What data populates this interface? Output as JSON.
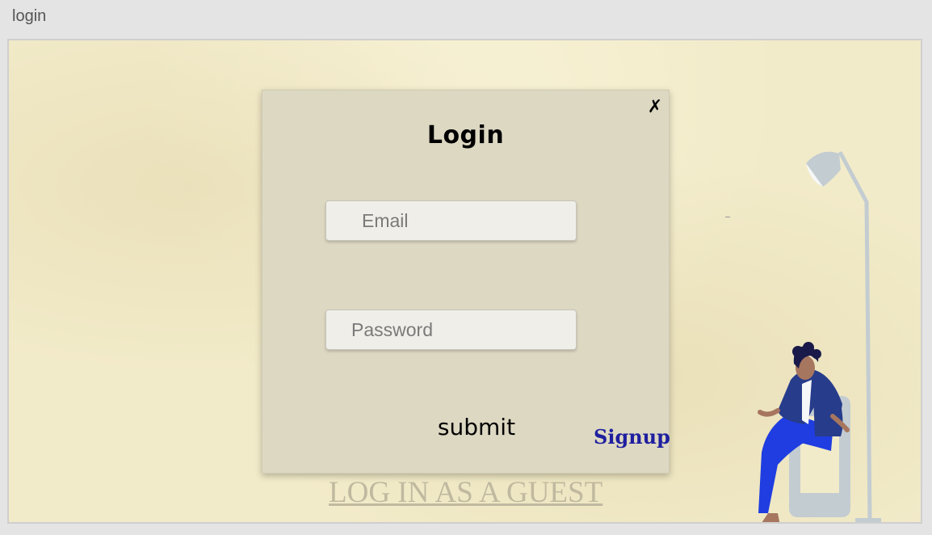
{
  "window": {
    "title": "login"
  },
  "modal": {
    "title": "Login",
    "close_label": "✗",
    "email_placeholder": "Email",
    "password_placeholder": "Password",
    "submit_label": "submit",
    "signup_label": "Signup"
  },
  "guest_link_label": "LOG IN AS A GUEST",
  "colors": {
    "background": "#f2ebc9",
    "modal": "#ddd8c2",
    "signup": "#1f1fa0",
    "guest": "#c0b9a0"
  },
  "icons": {
    "close": "close-icon",
    "illustration": "person-with-lamp-illustration"
  }
}
